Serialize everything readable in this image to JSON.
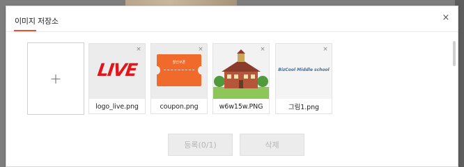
{
  "modal": {
    "title": "이미지 저장소",
    "close_symbol": "×",
    "accent_color": "#e8542f"
  },
  "add_tile": {
    "symbol": "+"
  },
  "images": [
    {
      "name": "logo_live.png",
      "delete_symbol": "×",
      "art_text": "LIVE",
      "icon": "live-logo-image"
    },
    {
      "name": "coupon.png",
      "delete_symbol": "×",
      "art_text": "할인쿠폰",
      "icon": "coupon-image"
    },
    {
      "name": "w6w15w.PNG",
      "delete_symbol": "×",
      "icon": "school-building-image"
    },
    {
      "name": "그림1.png",
      "delete_symbol": "×",
      "art_text": "BizCool Middle school",
      "icon": "school-banner-image"
    }
  ],
  "footer": {
    "register_label": "등록(0/1)",
    "delete_label": "삭제"
  }
}
